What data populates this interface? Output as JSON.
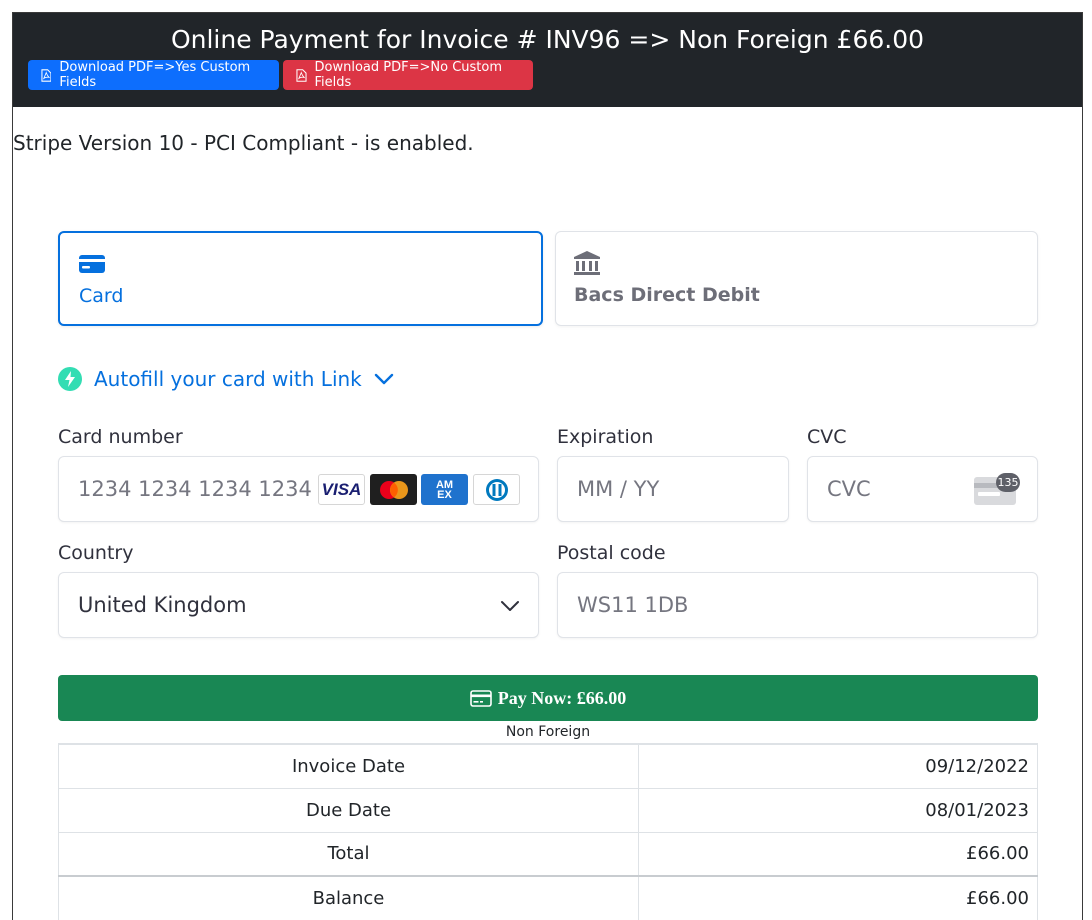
{
  "header": {
    "title": "Online Payment for Invoice # INV96 => Non Foreign £66.00",
    "pdf_yes_label": "Download PDF=>Yes Custom Fields",
    "pdf_no_label": "Download PDF=>No Custom Fields"
  },
  "stripe_note": "Stripe Version 10 - PCI Compliant - is enabled.",
  "payment_tabs": [
    {
      "label": "Card",
      "icon": "card-icon",
      "selected": true
    },
    {
      "label": "Bacs Direct Debit",
      "icon": "bank-icon",
      "selected": false
    }
  ],
  "link": {
    "label": "Autofill your card with Link"
  },
  "form": {
    "card_number": {
      "label": "Card number",
      "placeholder": "1234 1234 1234 1234",
      "brands": [
        "VISA",
        "mastercard",
        "AMEX",
        "diners"
      ]
    },
    "expiration": {
      "label": "Expiration",
      "placeholder": "MM / YY"
    },
    "cvc": {
      "label": "CVC",
      "placeholder": "CVC",
      "badge": "135"
    },
    "country": {
      "label": "Country",
      "value": "United Kingdom"
    },
    "postal": {
      "label": "Postal code",
      "placeholder": "WS11 1DB"
    }
  },
  "pay_button": {
    "label": "Pay Now: £66.00"
  },
  "pay_subtext": "Non Foreign",
  "summary": [
    {
      "label": "Invoice Date",
      "value": "09/12/2022"
    },
    {
      "label": "Due Date",
      "value": "08/01/2023"
    },
    {
      "label": "Total",
      "value": "£66.00"
    },
    {
      "label": "Balance",
      "value": "£66.00"
    }
  ],
  "colors": {
    "header_bg": "#212529",
    "primary": "#0d6efd",
    "danger": "#dc3545",
    "stripe_accent": "#0570de",
    "success": "#198754",
    "link_green": "#33ddb3"
  }
}
